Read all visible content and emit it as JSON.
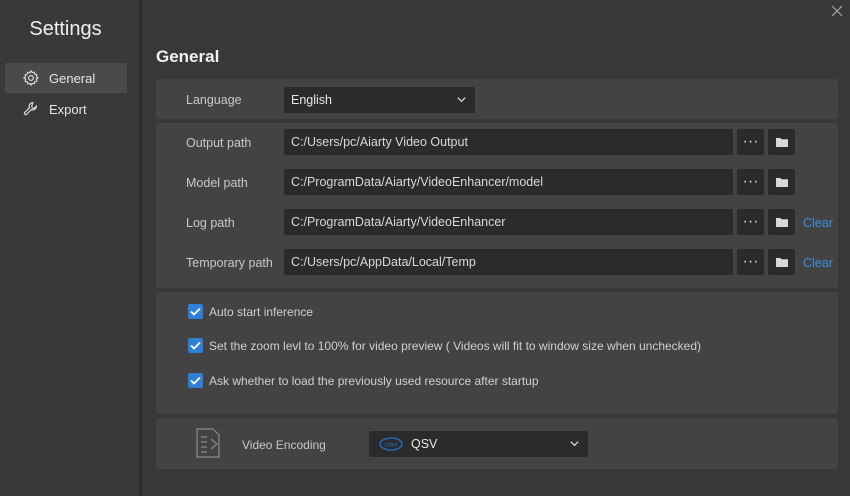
{
  "sidebar": {
    "title": "Settings",
    "items": [
      {
        "label": "General",
        "icon": "gear-icon",
        "active": true
      },
      {
        "label": "Export",
        "icon": "wrench-icon",
        "active": false
      }
    ]
  },
  "main": {
    "title": "General",
    "language": {
      "label": "Language",
      "value": "English"
    },
    "paths": [
      {
        "label": "Output path",
        "value": "C:/Users/pc/Aiarty Video Output",
        "more": "···",
        "clear": ""
      },
      {
        "label": "Model path",
        "value": "C:/ProgramData/Aiarty/VideoEnhancer/model",
        "more": "···",
        "clear": ""
      },
      {
        "label": "Log path",
        "value": "C:/ProgramData/Aiarty/VideoEnhancer",
        "more": "···",
        "clear": "Clear"
      },
      {
        "label": "Temporary path",
        "value": "C:/Users/pc/AppData/Local/Temp",
        "more": "···",
        "clear": "Clear"
      }
    ],
    "options": [
      {
        "label": "Auto start inference",
        "checked": true
      },
      {
        "label": "Set the zoom levl to 100% for video preview ( Videos will fit to window size when unchecked)",
        "checked": true
      },
      {
        "label": "Ask whether to load the previously used resource after startup",
        "checked": true
      }
    ],
    "encoding": {
      "label": "Video Encoding",
      "brand": "intel",
      "value": "QSV"
    }
  },
  "colors": {
    "accent": "#2f7fd6",
    "link": "#3d8ee6",
    "panel": "#434343",
    "field": "#2b2b2b"
  }
}
